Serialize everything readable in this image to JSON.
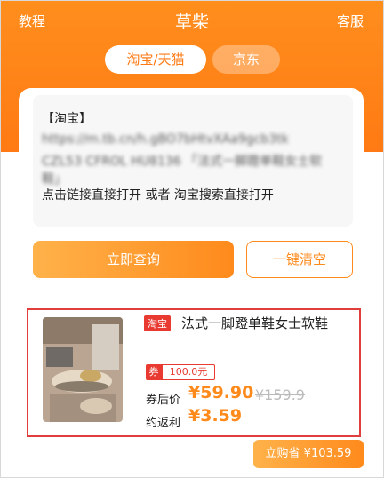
{
  "topbar": {
    "left_label": "教程",
    "title": "草柴",
    "right_label": "客服"
  },
  "tabs": [
    {
      "label": "淘宝/天猫",
      "active": true
    },
    {
      "label": "京东",
      "active": false
    }
  ],
  "input": {
    "line1": "【淘宝】",
    "line2": "https://m.tb.cn/h.gBO7bHtvXAa9gcb3tk",
    "line3": "CZL53 CFROL HU8136 「法式一脚蹬单鞋女士软",
    "line4": "鞋」",
    "line5": "点击链接直接打开 或者 淘宝搜索直接打开"
  },
  "buttons": {
    "query": "立即查询",
    "clear": "一键清空"
  },
  "product": {
    "platform_tag": "淘宝",
    "title": "法式一脚蹬单鞋女士软鞋",
    "coupon_label": "券",
    "coupon_value": "100.0元",
    "price_label": "券后价",
    "price_now": "¥59.90",
    "price_old": "¥159.9",
    "rebate_label": "约返利",
    "rebate_value": "¥3.59"
  },
  "buy_button": "立购省 ¥103.59",
  "colors": {
    "brand_orange": "#ff7a14",
    "red_tag": "#e93a32",
    "highlight_border": "#e23d3d"
  }
}
